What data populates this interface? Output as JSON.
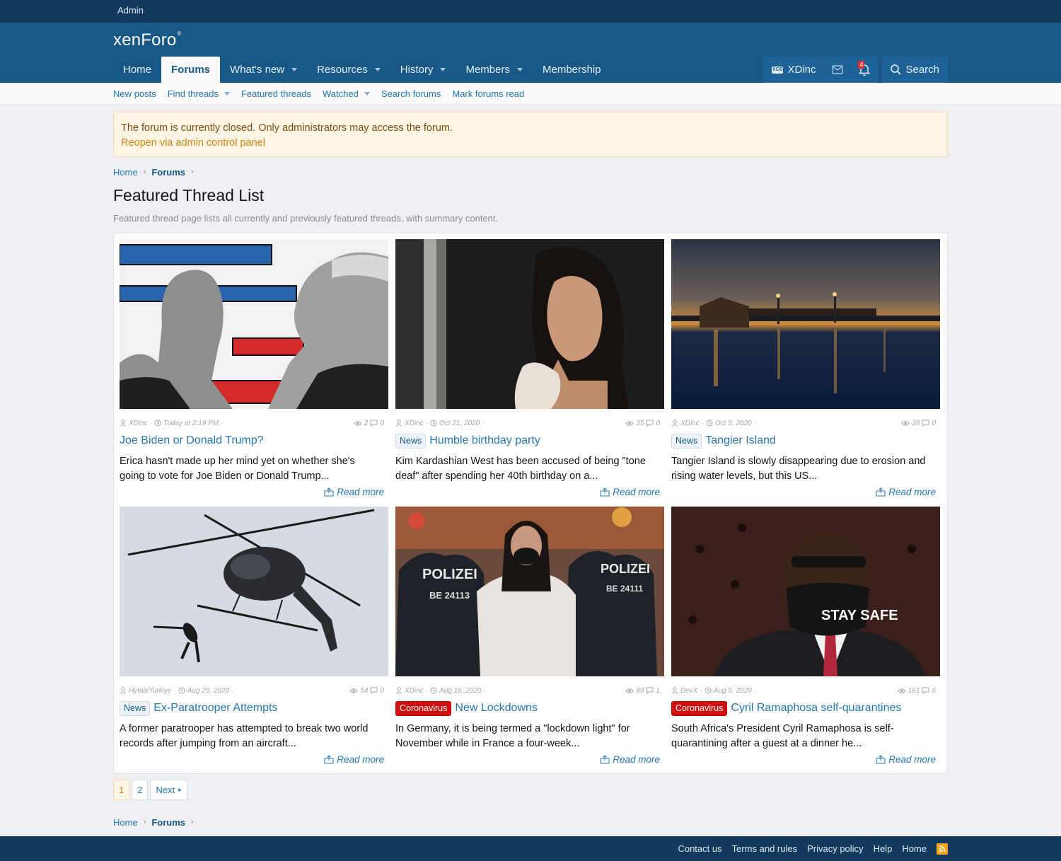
{
  "admin_bar": {
    "admin_label": "Admin"
  },
  "header": {
    "logo_text": "xenForo",
    "logo_mark": "®",
    "nav": [
      {
        "label": "Home",
        "active": false,
        "dropdown": false
      },
      {
        "label": "Forums",
        "active": true,
        "dropdown": false
      },
      {
        "label": "What's new",
        "active": false,
        "dropdown": true
      },
      {
        "label": "Resources",
        "active": false,
        "dropdown": true
      },
      {
        "label": "History",
        "active": false,
        "dropdown": true
      },
      {
        "label": "Members",
        "active": false,
        "dropdown": true
      },
      {
        "label": "Membership",
        "active": false,
        "dropdown": false
      }
    ],
    "user": {
      "name": "XDinc",
      "avatar_text": "XCB"
    },
    "alerts_count": "4",
    "search_label": "Search"
  },
  "subnav": [
    {
      "label": "New posts",
      "dropdown": false
    },
    {
      "label": "Find threads",
      "dropdown": true
    },
    {
      "label": "Featured threads",
      "dropdown": false
    },
    {
      "label": "Watched",
      "dropdown": true
    },
    {
      "label": "Search forums",
      "dropdown": false
    },
    {
      "label": "Mark forums read",
      "dropdown": false
    }
  ],
  "notice": {
    "text": "The forum is currently closed. Only administrators may access the forum.",
    "link": "Reopen via admin control panel"
  },
  "breadcrumb": {
    "home": "Home",
    "forums": "Forums"
  },
  "page": {
    "title": "Featured Thread List",
    "description": "Featured thread page lists all currently and previously featured threads, with summary content."
  },
  "cards": [
    {
      "author": "XDinc",
      "date": "Today at 2:19 PM",
      "views": "2",
      "replies": "0",
      "prefix": "",
      "prefix_type": "",
      "title": "Joe Biden or Donald Trump?",
      "snippet": "Erica hasn't made up her mind yet on whether she's going to vote for Joe Biden or Donald Trump...",
      "read_more": "Read more"
    },
    {
      "author": "XDinc",
      "date": "Oct 21, 2020",
      "views": "35",
      "replies": "0",
      "prefix": "News",
      "prefix_type": "news",
      "title": "Humble birthday party",
      "snippet": "Kim Kardashian West has been accused of being \"tone deaf\" after spending her 40th birthday on a...",
      "read_more": "Read more"
    },
    {
      "author": "XDinc",
      "date": "Oct 5, 2020",
      "views": "28",
      "replies": "0",
      "prefix": "News",
      "prefix_type": "news",
      "title": "Tangier Island",
      "snippet": "Tangier Island is slowly disappearing due to erosion and rising water levels, but this US...",
      "read_more": "Read more"
    },
    {
      "author": "HytaleTurkiye",
      "date": "Aug 29, 2020",
      "views": "54",
      "replies": "0",
      "prefix": "News",
      "prefix_type": "news",
      "title": "Ex-Paratrooper Attempts",
      "snippet": "A former paratrooper has attempted to break two world records after jumping from an aircraft...",
      "read_more": "Read more"
    },
    {
      "author": "XDinc",
      "date": "Aug 16, 2020",
      "views": "89",
      "replies": "1",
      "prefix": "Coronavirus",
      "prefix_type": "corona",
      "title": "New Lockdowns",
      "snippet": "In Germany, it is being termed a \"lockdown light\" for November while in France a four-week...",
      "read_more": "Read more"
    },
    {
      "author": "DevX",
      "date": "Aug 5, 2020",
      "views": "161",
      "replies": "6",
      "prefix": "Coronavirus",
      "prefix_type": "corona",
      "title": "Cyril Ramaphosa self-quarantines",
      "snippet": "South Africa's President Cyril Ramaphosa is self-quarantining after a guest at a dinner he...",
      "read_more": "Read more"
    }
  ],
  "image_overlays": {
    "police_1": "POLIZEI",
    "police_1_sub": "BE 24113",
    "police_2": "POLIZEI",
    "police_2_sub": "BE 24111",
    "mask": "STAY SAFE"
  },
  "pagination": {
    "pages": [
      "1",
      "2"
    ],
    "current": "1",
    "next": "Next"
  },
  "footer": {
    "links": [
      "Contact us",
      "Terms and rules",
      "Privacy policy",
      "Help",
      "Home"
    ]
  },
  "colors": {
    "header": "#185886",
    "admin_bar": "#133a5c",
    "link": "#2577b1",
    "corona": "#d10f0f"
  }
}
